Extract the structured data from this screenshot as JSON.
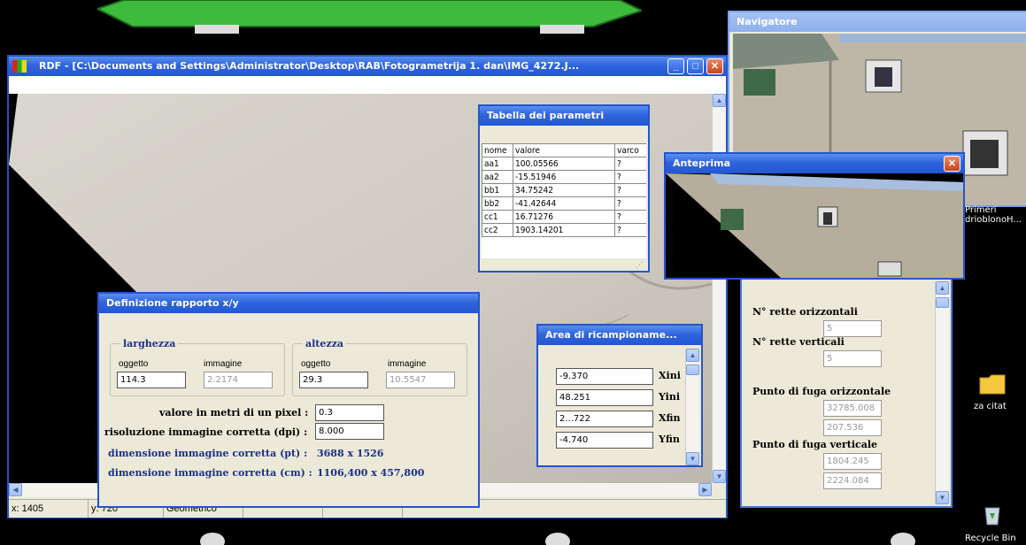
{
  "main_window": {
    "title": "RDF - [C:\\Documents and Settings\\Administrator\\Desktop\\RAB\\Fotogrametrija 1. dan\\IMG_4272.J...",
    "statusbar": [
      "x: 1405",
      "y: 720",
      "Geometrico"
    ]
  },
  "parametri": {
    "title": "Tabella dei parametri",
    "columns": [
      "nome",
      "valore",
      "varco"
    ],
    "rows": [
      [
        "aa1",
        "100.05566",
        "?"
      ],
      [
        "aa2",
        "-15.51946",
        "?"
      ],
      [
        "bb1",
        "34.75242",
        "?"
      ],
      [
        "bb2",
        "-41.42644",
        "?"
      ],
      [
        "cc1",
        "16.71276",
        "?"
      ],
      [
        "cc2",
        "1903.14201",
        "?"
      ]
    ]
  },
  "navigatore": {
    "title": "Navigatore"
  },
  "anteprima": {
    "title": "Anteprima"
  },
  "rapporto": {
    "title": "Definizione rapporto x/y",
    "larghezza_label": "larghezza",
    "altezza_label": "altezza",
    "oggetto_label": "oggetto",
    "immagine_label": "immagine",
    "larg_oggetto": "114.3",
    "larg_immagine": "2.2174",
    "alt_oggetto": "29.3",
    "alt_immagine": "10.5547",
    "pixel_label": "valore in metri di un pixel :",
    "pixel_value": "0.3",
    "risoluzione_label": "risoluzione immagine corretta (dpi) :",
    "risoluzione_value": "8.000",
    "dim_px_label": "dimensione immagine corretta (pt) :",
    "dim_px_value": "3688 x 1526",
    "dim_cm_label": "dimensione immagine corretta (cm) :",
    "dim_cm_value": "1106,400 x 457,800"
  },
  "area": {
    "title": "Area di ricampioname...",
    "rows": [
      {
        "value": "-9.370",
        "label": "Xini"
      },
      {
        "value": "48.251",
        "label": "Yini"
      },
      {
        "value": "2...722",
        "label": "Xfin"
      },
      {
        "value": "-4.740",
        "label": "Yfin"
      }
    ]
  },
  "rette": {
    "orizzontali_label": "N° rette orizzontali",
    "orizzontali_value": "5",
    "verticali_label": "N° rette verticali",
    "verticali_value": "5",
    "fuga_orizz_label": "Punto di fuga orizzontale",
    "fuga_orizz_x": "32785.008",
    "fuga_orizz_y": "207.536",
    "fuga_vert_label": "Punto di fuga verticale",
    "fuga_vert_x": "1804.245",
    "fuga_vert_y": "2224.084"
  },
  "desktop": {
    "icon1_label": "Primeri\ndrioblonoH...",
    "folder_label": "za citat",
    "recycle_label": "Recycle Bin"
  }
}
